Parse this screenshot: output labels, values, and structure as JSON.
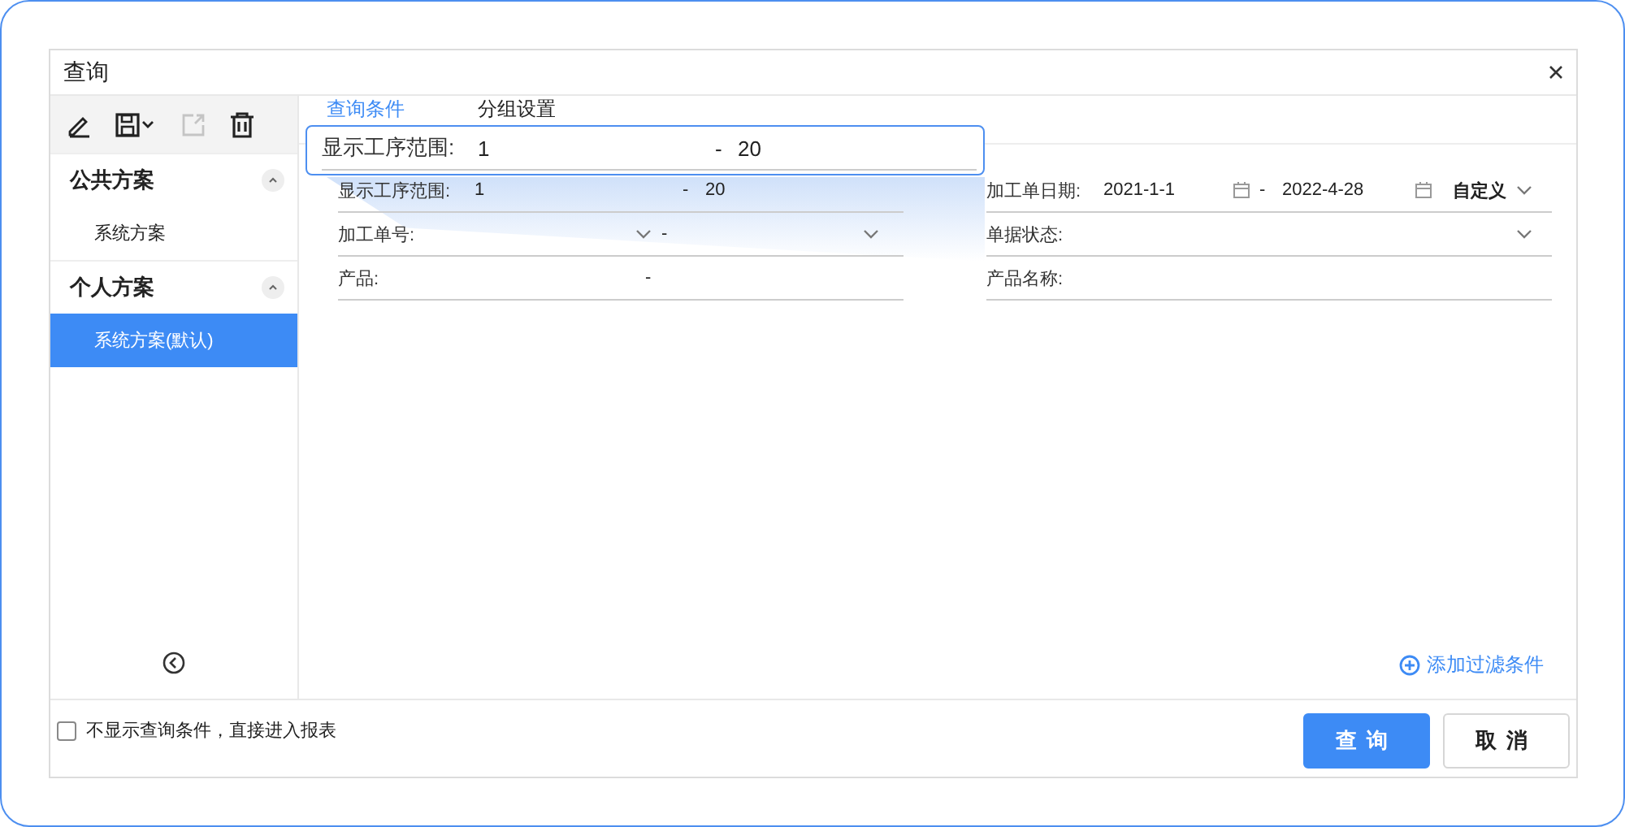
{
  "window": {
    "title": "查询"
  },
  "toolbar": [
    {
      "kind": "edit",
      "disabled": false
    },
    {
      "kind": "save",
      "disabled": false
    },
    {
      "kind": "export",
      "disabled": true
    },
    {
      "kind": "delete",
      "disabled": false
    }
  ],
  "sidebar": {
    "groups": [
      {
        "title": "公共方案",
        "expanded": true,
        "items": [
          {
            "label": "系统方案",
            "selected": false
          }
        ]
      },
      {
        "title": "个人方案",
        "expanded": true,
        "items": [
          {
            "label": "系统方案(默认)",
            "selected": true
          }
        ]
      }
    ]
  },
  "tabs": [
    {
      "label": "查询条件",
      "selected": true
    },
    {
      "label": "分组设置",
      "selected": false
    }
  ],
  "left_fields": [
    {
      "kind": "range",
      "label": "显示工序范围:",
      "from": "1",
      "separator": "-",
      "to": "20"
    },
    {
      "kind": "select-range",
      "label": "加工单号:",
      "separator": "-"
    },
    {
      "kind": "text-range",
      "label": "产品:",
      "separator": "-"
    }
  ],
  "right_fields": [
    {
      "kind": "date-range",
      "label": "加工单日期:",
      "from": "2021-1-1",
      "separator": "-",
      "to": "2022-4-28",
      "period": "自定义"
    },
    {
      "kind": "select",
      "label": "单据状态:"
    },
    {
      "kind": "text",
      "label": "产品名称:"
    }
  ],
  "callout": {
    "label": "显示工序范围:",
    "from": "1",
    "separator": "-",
    "to": "20"
  },
  "add_filter": "添加过滤条件",
  "skip_option": {
    "label": "不显示查询条件，直接进入报表",
    "checked": false
  },
  "buttons": [
    {
      "kind": "primary",
      "label": "查询"
    },
    {
      "kind": "default",
      "label": "取消"
    }
  ]
}
